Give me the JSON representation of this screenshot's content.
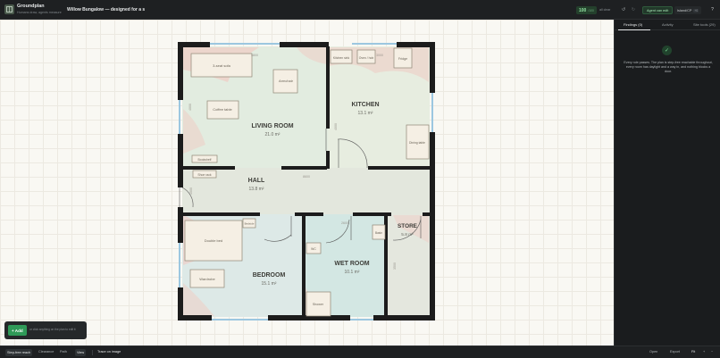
{
  "topbar": {
    "app_name": "Groundplan",
    "app_subtitle": "Humans draw, agents measure",
    "project_title": "Willow Bungalow — designed for a s",
    "score": "100",
    "score_unit": "/100",
    "clear_label": "all clear",
    "undo": "↺",
    "redo": "↻",
    "agent_label": "Agent can edit",
    "mcp_label": "Island/CP",
    "mcp_badge": "+0",
    "help": "?"
  },
  "rooms": {
    "living": {
      "name": "LIVING ROOM",
      "area": "21.0 m²"
    },
    "kitchen": {
      "name": "KITCHEN",
      "area": "13.1 m²"
    },
    "hall": {
      "name": "HALL",
      "area": "13.8 m²"
    },
    "bedroom": {
      "name": "BEDROOM",
      "area": "15.1 m²"
    },
    "wetroom": {
      "name": "WET ROOM",
      "area": "10.1 m²"
    },
    "store": {
      "name": "STORE",
      "area": "5.8 m²"
    }
  },
  "furniture": {
    "sofa": "3-seat sofa",
    "armchair": "Armchair",
    "coffee_table": "Coffee table",
    "bookshelf": "Bookshelf",
    "shoe_rack": "Shoe rack",
    "kitchen_sink": "Kitchen sink",
    "oven_hob": "Oven / hob",
    "fridge": "Fridge",
    "dining_table": "Dining table",
    "double_bed": "Double bed",
    "wardrobe": "Wardrobe",
    "bedside": "Bedside",
    "wc": "WC",
    "basin": "Basin",
    "shower": "Shower"
  },
  "dimensions": {
    "living_width": "3800",
    "living_height": "4000",
    "kitchen_height": "4000",
    "kitchen_width": "3000",
    "hall_width": "8600",
    "hall_height": "1500",
    "bathroom_width": "2600",
    "store_height": "3500"
  },
  "add_panel": {
    "add_label": "+ Add",
    "hint": "or click anything on the plan to edit it"
  },
  "sidepanel": {
    "tabs": [
      "Findings (0)",
      "Activity",
      "Site tools (29)"
    ],
    "check": "✓",
    "findings_text": "Every rule passes. The plan is step-free reachable throughout, every room has daylight and a way in, and nothing blocks a door."
  },
  "bottombar": {
    "step_free": "Step-free reach",
    "clearance": "Clearance",
    "path": "Path",
    "view": "View",
    "trace": "Trace on image",
    "open": "Open",
    "export": "Export",
    "fit": "Fit",
    "zoom_in": "+",
    "zoom_out": "−"
  },
  "colors": {
    "accent_green": "#2f9a58",
    "wall": "#1c1c1c",
    "living_fill": "#e2ece0",
    "kitchen_fill": "#e7ede0",
    "hall_fill": "#e3e7dd",
    "bedroom_fill": "#dde9e7",
    "wetroom_fill": "#d3e7e3",
    "store_fill": "#e4e7de"
  }
}
